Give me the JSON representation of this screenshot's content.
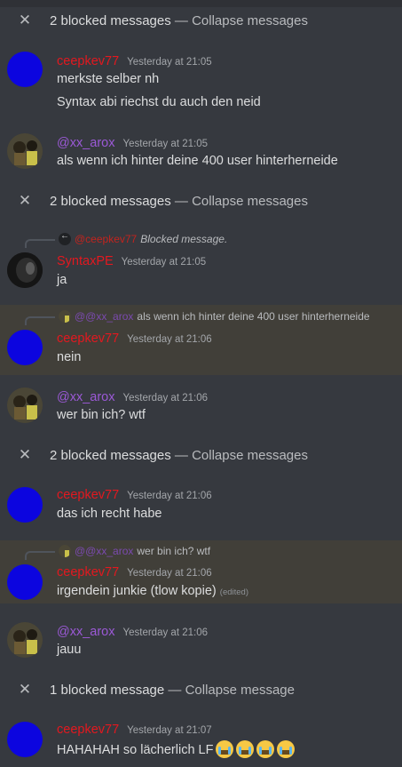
{
  "blocked": [
    {
      "text": "2 blocked messages",
      "sep": " — ",
      "action": "Collapse messages"
    },
    {
      "text": "2 blocked messages",
      "sep": " — ",
      "action": "Collapse messages"
    },
    {
      "text": "2 blocked messages",
      "sep": " — ",
      "action": "Collapse messages"
    },
    {
      "text": "1 blocked message",
      "sep": " — ",
      "action": "Collapse message"
    }
  ],
  "close_glyph": "✕",
  "messages": [
    {
      "user": "ceepkev77",
      "time": "Yesterday at 21:05",
      "lines": [
        "merkste selber nh",
        "Syntax abi riechst du auch den neid"
      ]
    },
    {
      "user": "@xx_arox",
      "time": "Yesterday at 21:05",
      "lines": [
        "als wenn ich hinter deine 400 user hinterherneide"
      ]
    },
    {
      "user": "SyntaxPE",
      "time": "Yesterday at 21:05",
      "lines": [
        "ja"
      ],
      "reply": {
        "name": "@ceepkev77",
        "text": "Blocked message."
      }
    },
    {
      "user": "ceepkev77",
      "time": "Yesterday at 21:06",
      "lines": [
        "nein"
      ],
      "reply": {
        "name": "@@xx_arox",
        "text": "als wenn ich hinter deine 400 user hinterherneide"
      }
    },
    {
      "user": "@xx_arox",
      "time": "Yesterday at 21:06",
      "lines": [
        "wer bin ich? wtf"
      ]
    },
    {
      "user": "ceepkev77",
      "time": "Yesterday at 21:06",
      "lines": [
        "das ich recht habe"
      ]
    },
    {
      "user": "ceepkev77",
      "time": "Yesterday at 21:06",
      "lines": [
        "irgendein junkie (tlow kopie)"
      ],
      "edited": "(edited)",
      "reply": {
        "name": "@@xx_arox",
        "text": "wer bin ich? wtf"
      }
    },
    {
      "user": "@xx_arox",
      "time": "Yesterday at 21:06",
      "lines": [
        "jauu"
      ]
    },
    {
      "user": "ceepkev77",
      "time": "Yesterday at 21:07",
      "lines": [
        "HAHAHAH so lächerlich LF"
      ],
      "emoji": "loudly-crying-face"
    }
  ],
  "colors": {
    "background": "#36393f",
    "highlight": "#413f39",
    "username_red": "#e3181f",
    "username_purple": "#9b59d6",
    "avatar_blue": "#0c05df"
  }
}
